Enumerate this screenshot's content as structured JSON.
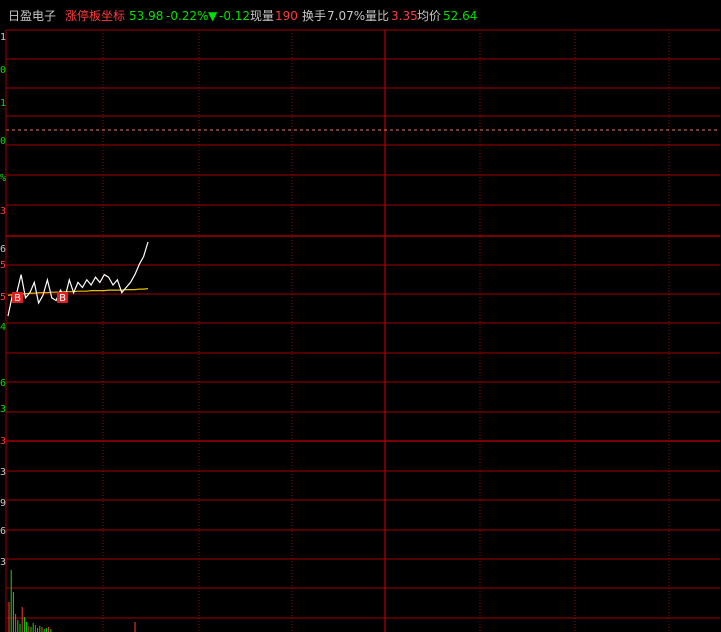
{
  "header": {
    "stock_name": "日盈电子",
    "indicator_name": "涨停板坐标",
    "price": "53.98",
    "change_pct": "-0.22%",
    "change_arrow": "▼",
    "change_abs": "-0.12",
    "volume_label": "现量",
    "volume_value": "190",
    "turnover_label": "换手",
    "turnover_value": "7.07%",
    "vol_ratio_label": "量比",
    "vol_ratio_value": "3.35",
    "avg_price_label": "均价",
    "avg_price_value": "52.64"
  },
  "colors": {
    "background": "#000000",
    "grid": "#a00000",
    "grid_dashed": "#e07a5f",
    "price_line": "#ffffff",
    "avg_line": "#e6c200",
    "up": "#ff3b3b",
    "down": "#00e000",
    "text": "#c8c8c8",
    "indicator": "#ff3b3b",
    "buy_marker": "#e02020"
  },
  "left_axis_fragments": [
    "1",
    "0",
    "1",
    "0",
    "%",
    "3",
    "6",
    "5",
    "5",
    "4",
    "6",
    "3",
    "3",
    "3",
    "9",
    "6",
    "3"
  ],
  "buy_markers": [
    "B",
    "B"
  ],
  "chart_data": {
    "type": "line",
    "title": "",
    "series": [
      {
        "name": "",
        "values": [
          52.55,
          52.95,
          53.0,
          53.35,
          52.9,
          53.0,
          53.2,
          52.8,
          52.95,
          53.25,
          52.9,
          52.85,
          53.05,
          52.9,
          53.25,
          53.0,
          53.2,
          53.1,
          53.25,
          53.15,
          53.3,
          53.2,
          53.35,
          53.3,
          53.15,
          53.25,
          53.0,
          53.1,
          53.2,
          53.35,
          53.55,
          53.7,
          53.98
        ]
      },
      {
        "name": "",
        "values": [
          52.95,
          52.96,
          52.97,
          52.98,
          52.98,
          52.99,
          52.99,
          53.0,
          53.0,
          53.0,
          53.01,
          53.01,
          53.01,
          53.02,
          53.02,
          53.02,
          53.03,
          53.03,
          53.03,
          53.04,
          53.04,
          53.04,
          53.04,
          53.05,
          53.05,
          53.05,
          53.05,
          53.06,
          53.06,
          53.06,
          53.07,
          53.07,
          53.08
        ]
      }
    ],
    "volume": [
      30,
      62,
      40,
      18,
      12,
      8,
      25,
      15,
      10,
      6,
      5,
      9,
      7,
      4,
      6,
      5,
      3,
      4,
      5,
      3
    ],
    "grid": true
  }
}
